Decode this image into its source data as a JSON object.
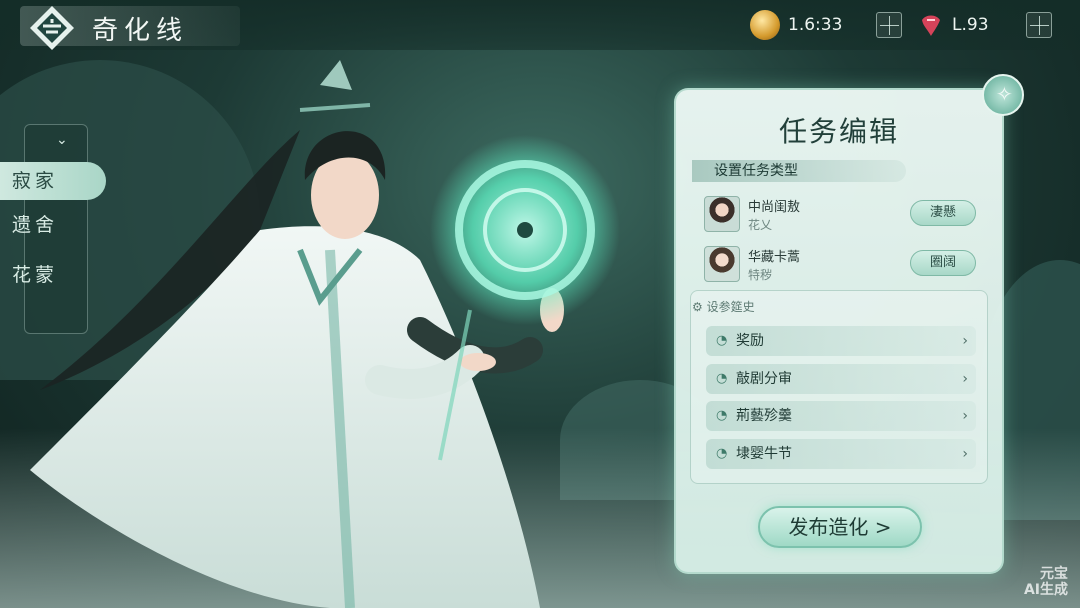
{
  "header": {
    "game_title": "奇化线",
    "coins": "1.6:33",
    "gems": "L.93"
  },
  "sidebar": {
    "items": [
      {
        "label": "寂家",
        "active": true
      },
      {
        "label": "遗舍",
        "active": false
      },
      {
        "label": "花蒙",
        "active": false
      }
    ]
  },
  "panel": {
    "title": "任务编辑",
    "section_label": "设置任务类型",
    "people": [
      {
        "name": "中尚闺敖",
        "role": "花乂",
        "button": "淒懸"
      },
      {
        "name": "华藏卡蒿",
        "role": "特秽",
        "button": "圈阔"
      }
    ],
    "settings_label": "设参筵史",
    "options": [
      {
        "label": "奖励"
      },
      {
        "label": "敲剧分审"
      },
      {
        "label": "荊藝殄羹"
      },
      {
        "label": "埭婴牛节"
      }
    ],
    "publish_label": "发布造化 >"
  },
  "watermark": {
    "line1": "元宝",
    "line2": "AI生成"
  },
  "colors": {
    "accent": "#9fd9c6",
    "panel_bg": "#e6f5ef",
    "glow": "#5ff2c6"
  },
  "icons": [
    "logo-icon",
    "coin-icon",
    "gem-icon",
    "grid-icon",
    "chevron-right-icon",
    "diamond-icon"
  ]
}
